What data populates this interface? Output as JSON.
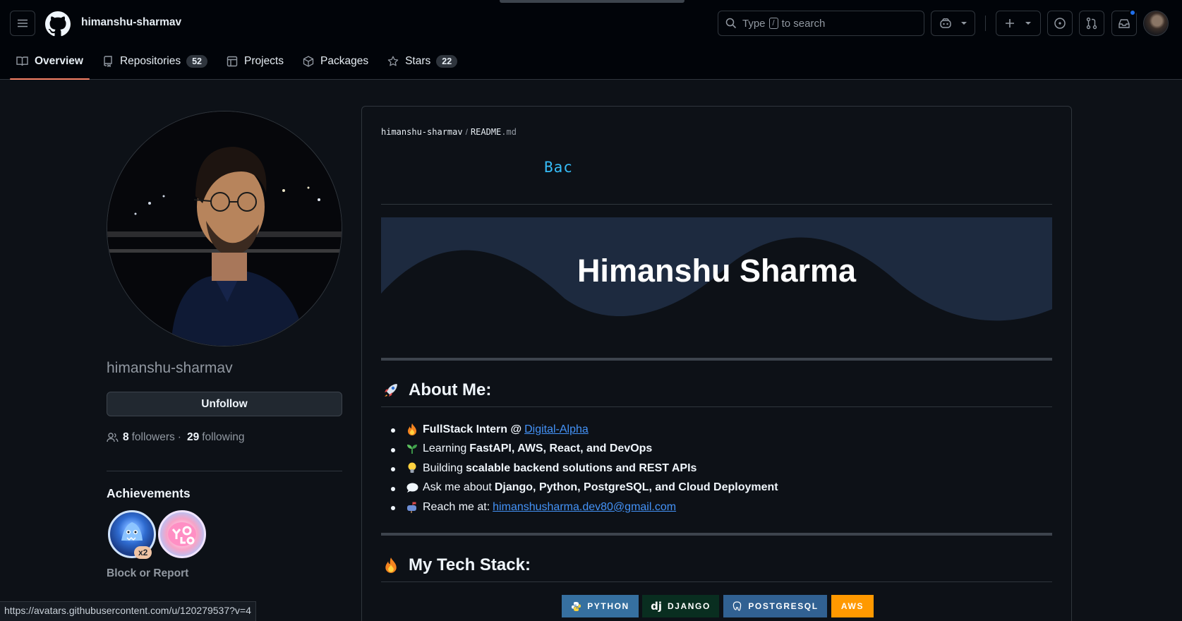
{
  "header": {
    "username": "himanshu-sharmav",
    "search": {
      "prefix": "Type",
      "key": "/",
      "suffix": "to search"
    }
  },
  "tabs": [
    {
      "label": "Overview",
      "icon": "book-icon",
      "active": true
    },
    {
      "label": "Repositories",
      "icon": "repo-icon",
      "count": "52"
    },
    {
      "label": "Projects",
      "icon": "table-icon"
    },
    {
      "label": "Packages",
      "icon": "package-icon"
    },
    {
      "label": "Stars",
      "icon": "star-icon",
      "count": "22"
    }
  ],
  "profile": {
    "login": "himanshu-sharmav",
    "unfollow_label": "Unfollow",
    "followers_count": "8",
    "followers_label": "followers",
    "following_count": "29",
    "following_label": "following",
    "achievements_title": "Achievements",
    "achievement_multiplier": "x2",
    "block_label": "Block or Report"
  },
  "status_url": "https://avatars.githubusercontent.com/u/120279537?v=4",
  "readme": {
    "crumb_user": "himanshu-sharmav",
    "crumb_file": "README",
    "crumb_ext": ".md",
    "typing_text": "Bac",
    "banner_title": "Himanshu Sharma",
    "about_heading": "About Me:",
    "about": {
      "l1_prefix": "FullStack Intern @",
      "l1_link": "Digital-Alpha",
      "l2_prefix": "Learning",
      "l2_bold": "FastAPI, AWS, React, and DevOps",
      "l3_prefix": "Building",
      "l3_bold": "scalable backend solutions and REST APIs",
      "l4_prefix": "Ask me about",
      "l4_bold": "Django, Python, PostgreSQL, and Cloud Deployment",
      "l5_prefix": "Reach me at:",
      "l5_link": "himanshusharma.dev80@gmail.com"
    },
    "stack_heading": "My Tech Stack:",
    "stack_badges": {
      "python": "PYTHON",
      "django": "DJANGO",
      "django_logo": "dj",
      "postgres": "POSTGRESQL",
      "aws": "AWS"
    }
  },
  "colors": {
    "bg": "#0d1117",
    "header_bg": "#010409",
    "link": "#4493f8",
    "tab_underline": "#f78166",
    "python_badge": "#3670a0",
    "django_badge": "#092e20",
    "postgres_badge": "#316192",
    "aws_badge": "#ff9900",
    "typing": "#36bcf7"
  }
}
